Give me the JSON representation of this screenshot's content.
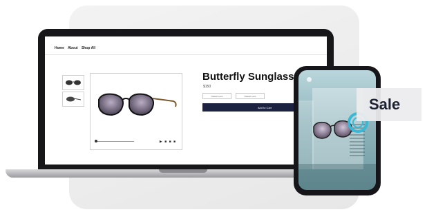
{
  "nav": {
    "items": [
      "Home",
      "About",
      "Shop All"
    ]
  },
  "product": {
    "title": "Butterfly Sunglass",
    "price": "$150",
    "options": [
      "Classic Lens",
      "Classic Lens"
    ],
    "cta": "Add to Cart"
  },
  "gallery": {
    "controls": "▶ ■ ■ ■"
  },
  "phone": {
    "sale_label": "Sale"
  },
  "icons": {
    "camera": "camera-dot-icon",
    "ar_ring": "ar-target-ring-icon"
  },
  "colors": {
    "primary_button": "#1c2340",
    "ar_ring": "#39b8d6",
    "lens": "#7e7288"
  }
}
